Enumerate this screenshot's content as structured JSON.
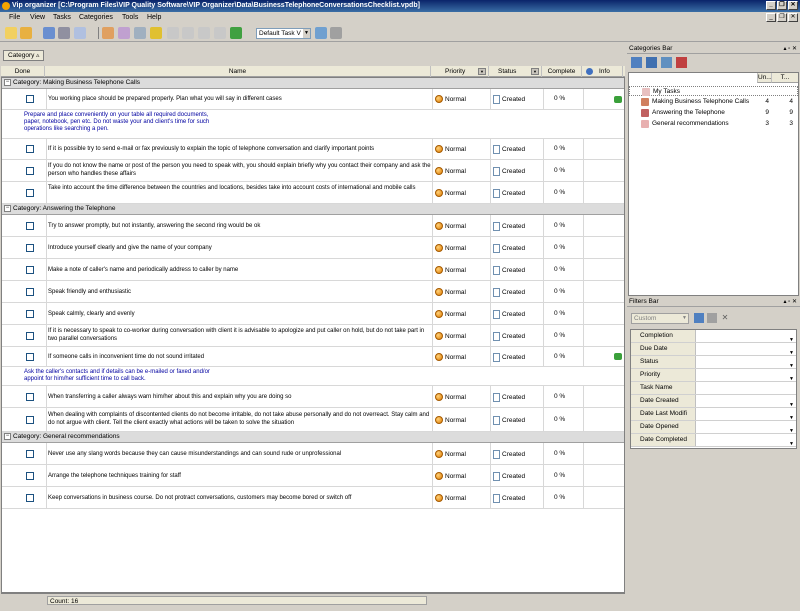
{
  "window": {
    "title": "Vip organizer [C:\\Program Files\\VIP Quality Software\\VIP Organizer\\Data\\BusinessTelephoneConversationsChecklist.vpdb]",
    "min": "_",
    "max": "❐",
    "close": "✕"
  },
  "menu": [
    "File",
    "View",
    "Tasks",
    "Categories",
    "Tools",
    "Help"
  ],
  "toolbar": {
    "view_combo": "Default Task V"
  },
  "group_panel": {
    "tag": "Category"
  },
  "columns": {
    "done": "Done",
    "name": "Name",
    "priority": "Priority",
    "status": "Status",
    "complete": "Complete",
    "info": "Info"
  },
  "categories": [
    {
      "label": "Category: Making Business Telephone Calls",
      "tasks": [
        {
          "name": "You working place should be prepared properly. Plan what you will say in different cases",
          "priority": "Normal",
          "status": "Created",
          "complete": "0 %",
          "note": true,
          "description": "Prepare and place conveniently on your table all required documents, paper, notebook, pen etc. Do not waste your and client's time for such operations like searching a pen."
        },
        {
          "name": "If it is possible try to send e-mail or fax previously to explain the topic of telephone conversation and clarify important points",
          "priority": "Normal",
          "status": "Created",
          "complete": "0 %"
        },
        {
          "name": "If you do not know the name or post of the person you need to speak with, you should explain briefly why you contact their company and ask the person who handles these affairs",
          "priority": "Normal",
          "status": "Created",
          "complete": "0 %"
        },
        {
          "name": "Take into account the time difference between the countries and locations, besides take into account costs of international and mobile calls",
          "priority": "Normal",
          "status": "Created",
          "complete": "0 %"
        }
      ]
    },
    {
      "label": "Category: Answering the Telephone",
      "tasks": [
        {
          "name": "Try to answer promptly, but not instantly, answering the second ring would be ok",
          "priority": "Normal",
          "status": "Created",
          "complete": "0 %"
        },
        {
          "name": "Introduce yourself  clearly and give the name of your company",
          "priority": "Normal",
          "status": "Created",
          "complete": "0 %"
        },
        {
          "name": "Make a note of caller's name and periodically address to caller by name",
          "priority": "Normal",
          "status": "Created",
          "complete": "0 %"
        },
        {
          "name": "Speak friendly and enthusiastic",
          "priority": "Normal",
          "status": "Created",
          "complete": "0 %"
        },
        {
          "name": "Speak calmly, clearly and evenly",
          "priority": "Normal",
          "status": "Created",
          "complete": "0 %"
        },
        {
          "name": "If it is necessary to speak to co-worker during conversation with client it is advisable to apologize and put caller on hold, but do not take part in two parallel conversations",
          "priority": "Normal",
          "status": "Created",
          "complete": "0 %"
        },
        {
          "name": "If someone calls in inconvenient time do not sound irritated",
          "priority": "Normal",
          "status": "Created",
          "complete": "0 %",
          "note": true,
          "description": "Ask the caller's contacts and if details can be e-mailed or faxed and/or appoint for him/her sufficient time to call back."
        },
        {
          "name": "When transferring a caller always warn him/her about this and explain why you are doing so",
          "priority": "Normal",
          "status": "Created",
          "complete": "0 %"
        },
        {
          "name": "When dealing with complaints of discontented clients do not become irritable, do not take abuse personally and do not overreact. Stay calm and do not argue with client. Tell the client exactly what actions will be taken to solve the situation",
          "priority": "Normal",
          "status": "Created",
          "complete": "0 %"
        }
      ]
    },
    {
      "label": "Category: General recommendations",
      "tasks": [
        {
          "name": "Never use any slang words because they can cause misunderstandings and can sound rude or unprofessional",
          "priority": "Normal",
          "status": "Created",
          "complete": "0 %"
        },
        {
          "name": "Arrange the telephone techniques training for staff",
          "priority": "Normal",
          "status": "Created",
          "complete": "0 %"
        },
        {
          "name": "Keep conversations in business course. Do not protract conversations, customers may become bored or switch off",
          "priority": "Normal",
          "status": "Created",
          "complete": "0 %"
        }
      ]
    }
  ],
  "status_bar": {
    "count": "Count: 16"
  },
  "categories_bar": {
    "title": "Categories Bar",
    "col1": "Un...",
    "col2": "T...",
    "items": [
      {
        "label": "My Tasks",
        "n1": "",
        "n2": ""
      },
      {
        "label": "Making Business Telephone Calls",
        "n1": "4",
        "n2": "4"
      },
      {
        "label": "Answering the Telephone",
        "n1": "9",
        "n2": "9"
      },
      {
        "label": "General recommendations",
        "n1": "3",
        "n2": "3"
      }
    ]
  },
  "filters_bar": {
    "title": "Filters Bar",
    "combo": "Custom",
    "fields": [
      "Completion",
      "Due Date",
      "Status",
      "Priority",
      "Task Name",
      "Date Created",
      "Date Last Modifi",
      "Date Opened",
      "Date Completed"
    ]
  },
  "colors": {
    "title_bar": "#0a246a",
    "description_text": "#0000a0",
    "category_row": "#dcdcdc",
    "selection": "#0a246a"
  }
}
